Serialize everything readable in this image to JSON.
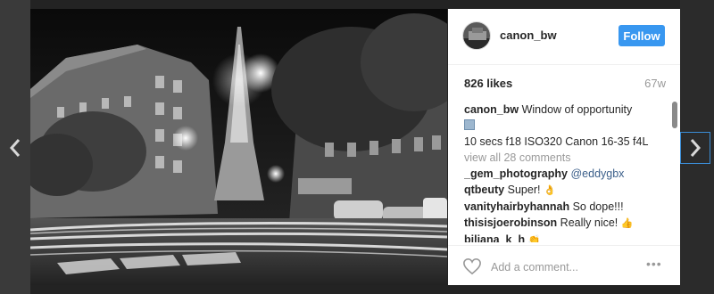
{
  "nav": {
    "prev_icon": "chevron-left-icon",
    "next_icon": "chevron-right-icon"
  },
  "post": {
    "photo_description_icon": "photo",
    "author": {
      "username": "canon_bw",
      "follow_label": "Follow"
    },
    "likes": "826 likes",
    "age": "67w",
    "caption": {
      "username": "canon_bw",
      "text_line1": "Window of opportunity",
      "text_line2": "10 secs f18 ISO320 Canon 16-35 f4L"
    },
    "view_all": "view all 28 comments",
    "comments": [
      {
        "user": "_gem_photography",
        "text": "@eddygbx"
      },
      {
        "user": "qtbeuty",
        "text": "Super!"
      },
      {
        "user": "vanityhairbyhannah",
        "text": "So dope!!!"
      },
      {
        "user": "thisisjoerobinson",
        "text": "Really nice!"
      },
      {
        "user": "biliana_k_h",
        "text": ""
      }
    ],
    "add_comment_placeholder": "Add a comment...",
    "more_label": "•••"
  },
  "colors": {
    "follow": "#3897f0",
    "mention": "#3b5f8a",
    "nav_focus": "#3b8dd6"
  }
}
